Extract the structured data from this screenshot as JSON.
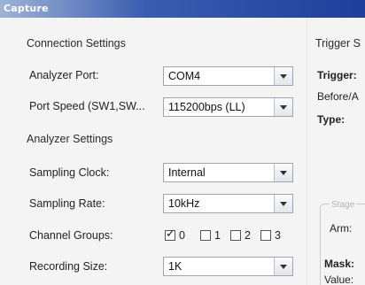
{
  "window": {
    "title": "Capture"
  },
  "connection": {
    "heading": "Connection Settings",
    "analyzer_port_label": "Analyzer Port:",
    "analyzer_port_value": "COM4",
    "port_speed_label": "Port Speed (SW1,SW...",
    "port_speed_value": "115200bps (LL)"
  },
  "analyzer": {
    "heading": "Analyzer Settings",
    "sampling_clock_label": "Sampling Clock:",
    "sampling_clock_value": "Internal",
    "sampling_rate_label": "Sampling Rate:",
    "sampling_rate_value": "10kHz",
    "channel_groups_label": "Channel Groups:",
    "channel_groups": [
      {
        "label": "0",
        "checked": true
      },
      {
        "label": "1",
        "checked": false
      },
      {
        "label": "2",
        "checked": false
      },
      {
        "label": "3",
        "checked": false
      }
    ],
    "recording_size_label": "Recording Size:",
    "recording_size_value": "1K"
  },
  "trigger": {
    "heading": "Trigger S",
    "trigger_label": "Trigger:",
    "before_after_label": "Before/A",
    "type_label": "Type:",
    "group_title": "Stage",
    "arm_label": "Arm:",
    "mask_label": "Mask:",
    "value_label": "Value:"
  },
  "icons": {
    "dropdown": "chevron-down-icon",
    "check": "check-icon"
  },
  "colors": {
    "titlebar_start": "#9fb3d6",
    "titlebar_end": "#1f3f9a",
    "panel_bg": "#f4f4f4",
    "field_border": "#9aa5b5"
  }
}
